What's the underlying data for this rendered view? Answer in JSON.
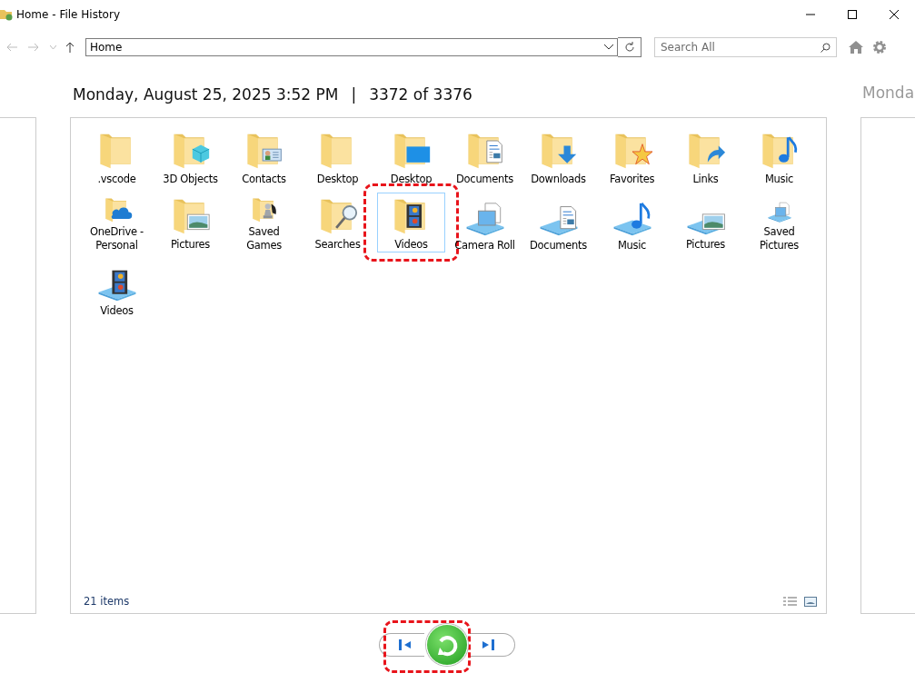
{
  "window": {
    "title": "Home - File History"
  },
  "address_bar": {
    "value": "Home"
  },
  "search": {
    "placeholder": "Search All"
  },
  "header": {
    "date": "Monday, August 25, 2025 3:52 PM",
    "separator": "|",
    "position": "3372 of 3376"
  },
  "next_panel": {
    "date": "Monda"
  },
  "items": [
    {
      "label": ".vscode",
      "kind": "plainfolder",
      "selected": false,
      "highlighted": false
    },
    {
      "label": "3D Objects",
      "kind": "cubefolder",
      "selected": false,
      "highlighted": false
    },
    {
      "label": "Contacts",
      "kind": "cardfolder",
      "selected": false,
      "highlighted": false
    },
    {
      "label": "Desktop",
      "kind": "plainfolder",
      "selected": false,
      "highlighted": false
    },
    {
      "label": "Desktop",
      "kind": "monitorfolder",
      "selected": false,
      "highlighted": false
    },
    {
      "label": "Documents",
      "kind": "documentfolder",
      "selected": false,
      "highlighted": false
    },
    {
      "label": "Downloads",
      "kind": "downloadfolder",
      "selected": false,
      "highlighted": false
    },
    {
      "label": "Favorites",
      "kind": "starfolder",
      "selected": false,
      "highlighted": false
    },
    {
      "label": "Links",
      "kind": "shortcutfolder",
      "selected": false,
      "highlighted": false
    },
    {
      "label": "Music",
      "kind": "notefolder",
      "selected": false,
      "highlighted": false
    },
    {
      "label": "OneDrive - Personal",
      "kind": "cloudfolder",
      "selected": false,
      "highlighted": false
    },
    {
      "label": "Pictures",
      "kind": "picturefolder",
      "selected": false,
      "highlighted": false
    },
    {
      "label": "Saved Games",
      "kind": "chessfolder",
      "selected": false,
      "highlighted": false
    },
    {
      "label": "Searches",
      "kind": "magnifierfolder",
      "selected": false,
      "highlighted": false
    },
    {
      "label": "Videos",
      "kind": "filmfolder",
      "selected": true,
      "highlighted": true
    },
    {
      "label": "Camera Roll",
      "kind": "pagelibrary",
      "selected": false,
      "highlighted": false
    },
    {
      "label": "Documents",
      "kind": "documentlibrary",
      "selected": false,
      "highlighted": false
    },
    {
      "label": "Music",
      "kind": "notelibrary",
      "selected": false,
      "highlighted": false
    },
    {
      "label": "Pictures",
      "kind": "picturelibrary",
      "selected": false,
      "highlighted": false
    },
    {
      "label": "Saved Pictures",
      "kind": "pagelibrary",
      "selected": false,
      "highlighted": false
    },
    {
      "label": "Videos",
      "kind": "filmlibrary",
      "selected": false,
      "highlighted": false
    }
  ],
  "status_bar": {
    "count": "21 items"
  },
  "restore": {
    "highlighted": true
  }
}
